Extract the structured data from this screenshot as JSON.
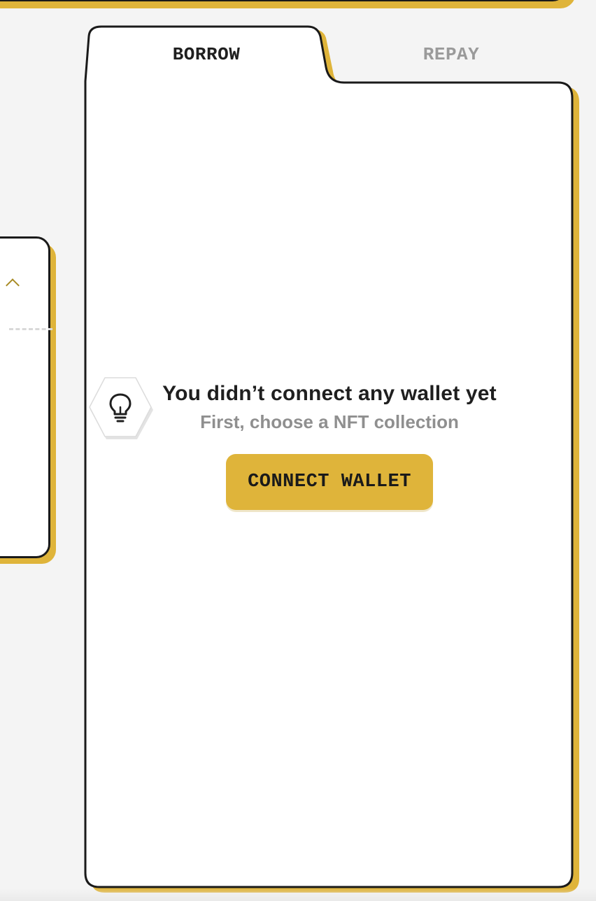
{
  "tabs": [
    {
      "label": "BORROW",
      "active": true
    },
    {
      "label": "REPAY",
      "active": false
    }
  ],
  "empty_state": {
    "icon": "lightbulb-icon",
    "title": "You didn’t connect any wallet yet",
    "subtitle": "First, choose a NFT collection",
    "button_label": "CONNECT WALLET"
  },
  "colors": {
    "accent": "#dfb43a",
    "border": "#1a1a1a",
    "background": "#f4f4f4",
    "muted_text": "#8f8f8f",
    "chevron": "#a88b25"
  }
}
